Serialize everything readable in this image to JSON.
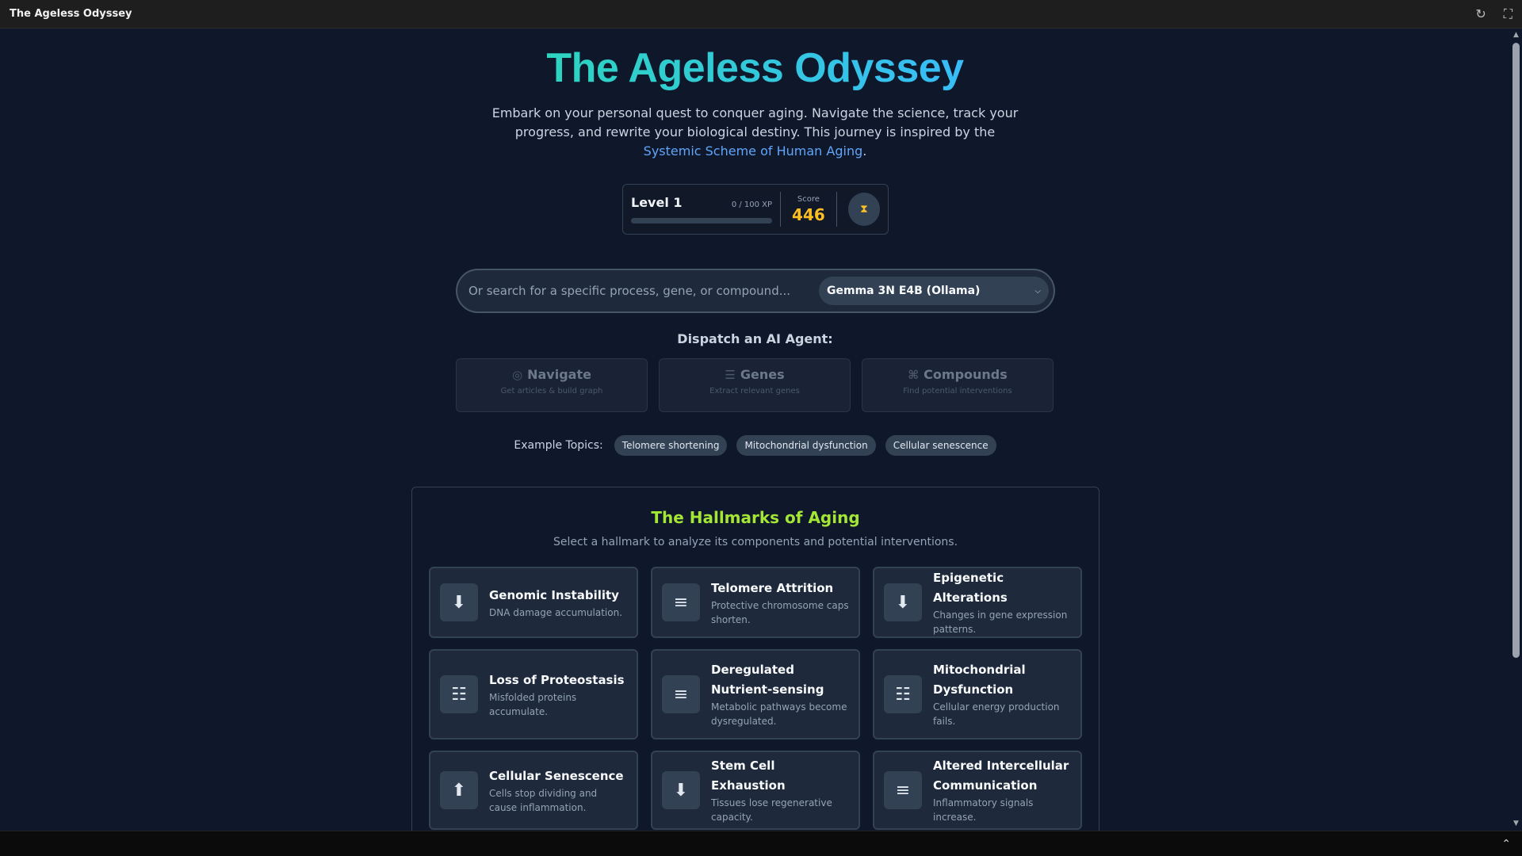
{
  "window": {
    "title": "The Ageless Odyssey"
  },
  "hero": {
    "title": "The Ageless Odyssey",
    "subtitle_part1": "Embark on your personal quest to conquer aging. Navigate the science, track your progress, and rewrite your biological destiny. This journey is inspired by the ",
    "subtitle_link": "Systemic Scheme of Human Aging",
    "subtitle_end": "."
  },
  "progress": {
    "level_label": "Level 1",
    "xp_text": "0 / 100 XP",
    "xp_fraction": 0,
    "score_label": "Score",
    "score_value": "446"
  },
  "search": {
    "placeholder": "Or search for a specific process, gene, or compound...",
    "model_selected": "Gemma 3N E4B (Ollama)"
  },
  "dispatch_label": "Dispatch an AI Agent:",
  "agents": [
    {
      "label": "Navigate",
      "sub": "Get articles & build graph",
      "icon": "compass-icon"
    },
    {
      "label": "Genes",
      "sub": "Extract relevant genes",
      "icon": "list-icon"
    },
    {
      "label": "Compounds",
      "sub": "Find potential interventions",
      "icon": "molecule-icon"
    }
  ],
  "topics": {
    "label": "Example Topics:",
    "items": [
      "Telomere shortening",
      "Mitochondrial dysfunction",
      "Cellular senescence"
    ]
  },
  "hallmarks": {
    "title": "The Hallmarks of Aging",
    "subtitle": "Select a hallmark to analyze its components and potential interventions.",
    "items": [
      {
        "name": "Genomic Instability",
        "desc": "DNA damage accumulation.",
        "icon": "arrow-down-icon"
      },
      {
        "name": "Telomere Attrition",
        "desc": "Protective chromosome caps shorten.",
        "icon": "bars-icon"
      },
      {
        "name": "Epigenetic Alterations",
        "desc": "Changes in gene expression patterns.",
        "icon": "arrow-down-icon"
      },
      {
        "name": "Loss of Proteostasis",
        "desc": "Misfolded proteins accumulate.",
        "icon": "sliders-icon"
      },
      {
        "name": "Deregulated Nutrient-sensing",
        "desc": "Metabolic pathways become dysregulated.",
        "icon": "bars-icon"
      },
      {
        "name": "Mitochondrial Dysfunction",
        "desc": "Cellular energy production fails.",
        "icon": "sliders-icon"
      },
      {
        "name": "Cellular Senescence",
        "desc": "Cells stop dividing and cause inflammation.",
        "icon": "chevron-up-circle-icon"
      },
      {
        "name": "Stem Cell Exhaustion",
        "desc": "Tissues lose regenerative capacity.",
        "icon": "arrow-down-icon"
      },
      {
        "name": "Altered Intercellular Communication",
        "desc": "Inflammatory signals increase.",
        "icon": "bars-icon"
      }
    ]
  }
}
